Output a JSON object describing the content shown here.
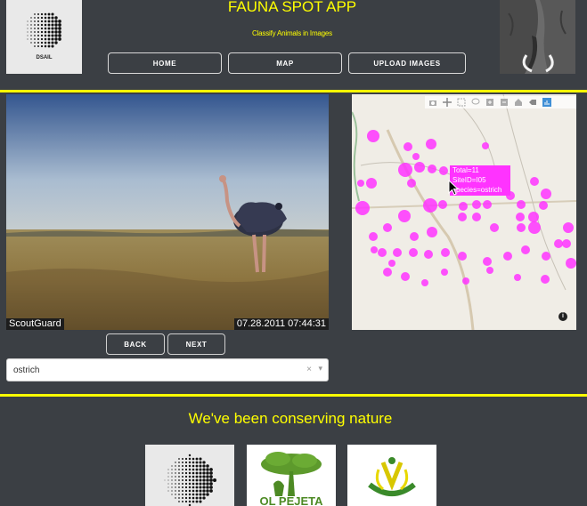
{
  "header": {
    "title": "FAUNA SPOT APP",
    "subtitle": "Classify Animals in Images",
    "logo_text": "DSAIL",
    "nav": [
      {
        "label": "HOME"
      },
      {
        "label": "MAP"
      },
      {
        "label": "UPLOAD IMAGES"
      }
    ]
  },
  "image_viewer": {
    "watermark_left": "ScoutGuard",
    "timestamp": "07.28.2011 07:44:31",
    "back_label": "BACK",
    "next_label": "NEXT",
    "species_select": {
      "value": "ostrich",
      "clear_glyph": "×",
      "arrow_glyph": "▾"
    }
  },
  "map": {
    "tooltip": {
      "line1": "Total=11",
      "line2": "SiteID=I05",
      "line3": "species=ostrich"
    },
    "info_glyph": "i",
    "marker_color": "#ff33ff",
    "toolbar_icons": [
      "camera-icon",
      "pan-icon",
      "box-select-icon",
      "lasso-icon",
      "zoom-in-icon",
      "zoom-out-icon",
      "home-icon",
      "autoscale-icon",
      "plotly-logo-icon"
    ]
  },
  "footer": {
    "heading": "We've been conserving nature",
    "sponsor_text": "OL PEJETA"
  },
  "colors": {
    "accent": "#ffff00",
    "background": "#3b3f44"
  }
}
